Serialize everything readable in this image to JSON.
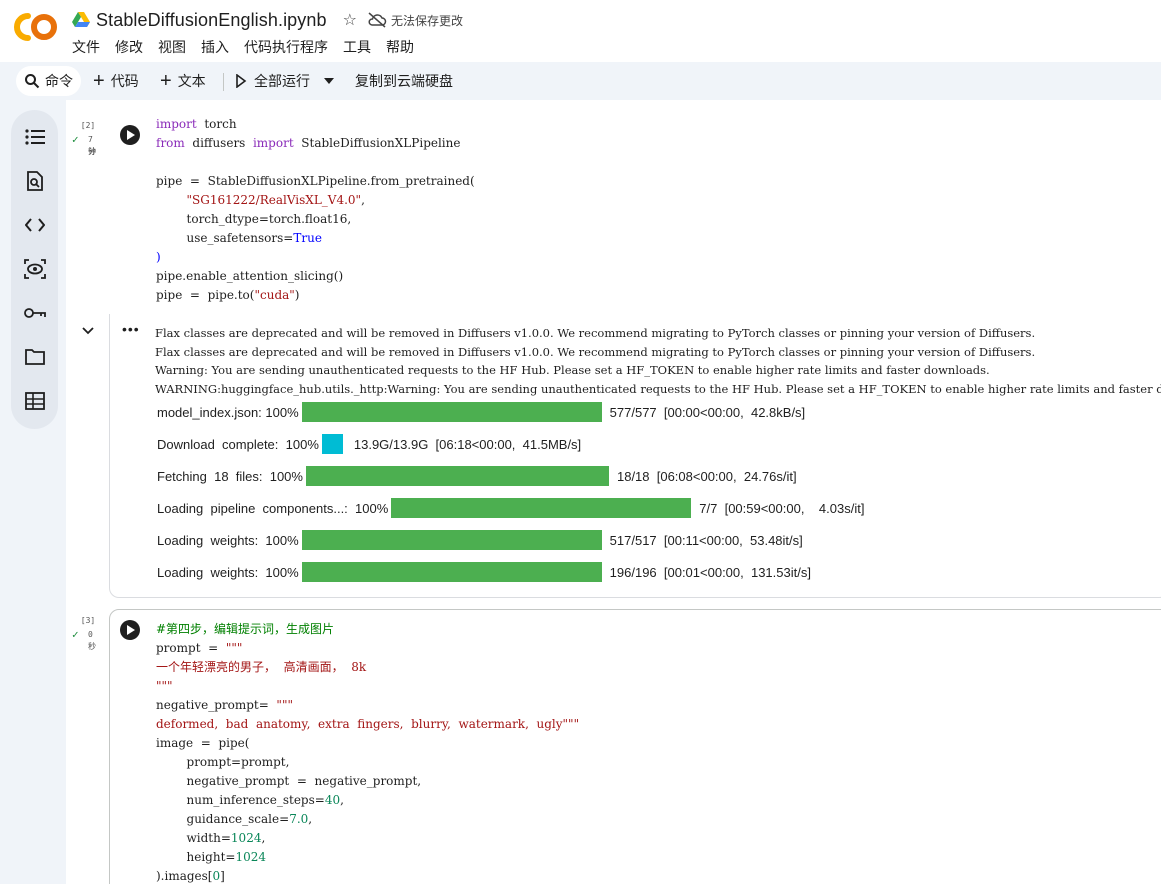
{
  "header": {
    "title": "StableDiffusionEnglish.ipynb",
    "save_status": "无法保存更改",
    "menu": [
      "文件",
      "修改",
      "视图",
      "插入",
      "代码执行程序",
      "工具",
      "帮助"
    ]
  },
  "toolbar": {
    "command": "命令",
    "add_code": "代码",
    "add_text": "文本",
    "run_all": "全部运行",
    "copy_drive": "复制到云端硬盘"
  },
  "rail": {
    "icons": [
      "toc-icon",
      "find-icon",
      "code-snippets-icon",
      "variables-icon",
      "secrets-key-icon",
      "files-folder-icon",
      "table-icon"
    ]
  },
  "cell1": {
    "exec_count": "[2]",
    "exec_time_1": "7 分",
    "exec_time_2": "钟"
  },
  "output1": {
    "lines": [
      "Flax classes are deprecated and will be removed in Diffusers v1.0.0. We recommend migrating to PyTorch classes or pinning your version of Diffusers.",
      "Flax classes are deprecated and will be removed in Diffusers v1.0.0. We recommend migrating to PyTorch classes or pinning your version of Diffusers.",
      "Warning: You are sending unauthenticated requests to the HF Hub. Please set a HF_TOKEN to enable higher rate limits and faster downloads.",
      "WARNING:huggingface_hub.utils._http:Warning: You are sending unauthenticated requests to the HF Hub. Please set a HF_TOKEN to enable higher rate limits and faster downloads."
    ],
    "progress": [
      {
        "label": "model_index.json: 100%",
        "stats": "577/577  [00:00<00:00,  42.8kB/s]",
        "fraction": 1.0,
        "color": "#4caf50"
      },
      {
        "label": "Download  complete:  100%",
        "stats": "13.9G/13.9G  [06:18<00:00,  41.5MB/s]",
        "fraction": 1.0,
        "color": "#00bcd4"
      },
      {
        "label": "Fetching  18  files:  100%",
        "stats": "18/18  [06:08<00:00,  24.76s/it]",
        "fraction": 1.0,
        "color": "#4caf50"
      },
      {
        "label": "Loading  pipeline  components...:  100%",
        "stats": "7/7  [00:59<00:00,    4.03s/it]",
        "fraction": 1.0,
        "color": "#4caf50"
      },
      {
        "label": "Loading  weights:  100%",
        "stats": "517/517  [00:11<00:00,  53.48it/s]",
        "fraction": 1.0,
        "color": "#4caf50"
      },
      {
        "label": "Loading  weights:  100%",
        "stats": "196/196  [00:01<00:00,  131.53it/s]",
        "fraction": 1.0,
        "color": "#4caf50"
      }
    ]
  },
  "cell2": {
    "exec_count": "[3]",
    "exec_time_1": "0",
    "exec_time_2": "秒"
  }
}
